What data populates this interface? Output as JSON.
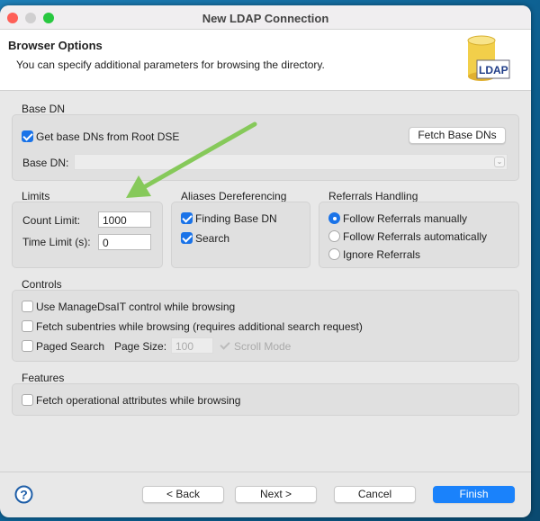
{
  "window": {
    "title": "New LDAP Connection"
  },
  "header": {
    "title": "Browser Options",
    "description": "You can specify additional parameters for browsing the directory.",
    "logo_text": "LDAP"
  },
  "base_dn": {
    "group_label": "Base DN",
    "get_from_root_dse": {
      "label": "Get base DNs from Root DSE",
      "checked": true
    },
    "fetch_button": "Fetch Base DNs",
    "base_dn_label": "Base DN:",
    "base_dn_value": ""
  },
  "limits": {
    "group_label": "Limits",
    "count_limit_label": "Count Limit:",
    "count_limit_value": "1000",
    "time_limit_label": "Time Limit (s):",
    "time_limit_value": "0"
  },
  "aliases": {
    "group_label": "Aliases Dereferencing",
    "items": [
      {
        "label": "Finding Base DN",
        "checked": true
      },
      {
        "label": "Search",
        "checked": true
      }
    ]
  },
  "referrals": {
    "group_label": "Referrals Handling",
    "options": [
      {
        "label": "Follow Referrals manually",
        "selected": true
      },
      {
        "label": "Follow Referrals automatically",
        "selected": false
      },
      {
        "label": "Ignore Referrals",
        "selected": false
      }
    ]
  },
  "controls": {
    "group_label": "Controls",
    "manage_dsait": {
      "label": "Use ManageDsaIT control while browsing",
      "checked": false
    },
    "fetch_subentries": {
      "label": "Fetch subentries while browsing (requires additional search request)",
      "checked": false
    },
    "paged_search": {
      "label": "Paged Search",
      "checked": false
    },
    "page_size_label": "Page Size:",
    "page_size_value": "100",
    "scroll_mode": {
      "label": "Scroll Mode",
      "checked": true,
      "disabled": true
    }
  },
  "features": {
    "group_label": "Features",
    "fetch_operational": {
      "label": "Fetch operational attributes while browsing",
      "checked": false
    }
  },
  "footer": {
    "back": "< Back",
    "next": "Next >",
    "cancel": "Cancel",
    "finish": "Finish"
  },
  "colors": {
    "accent": "#1a82fb",
    "annotation_arrow": "#86c95a"
  }
}
